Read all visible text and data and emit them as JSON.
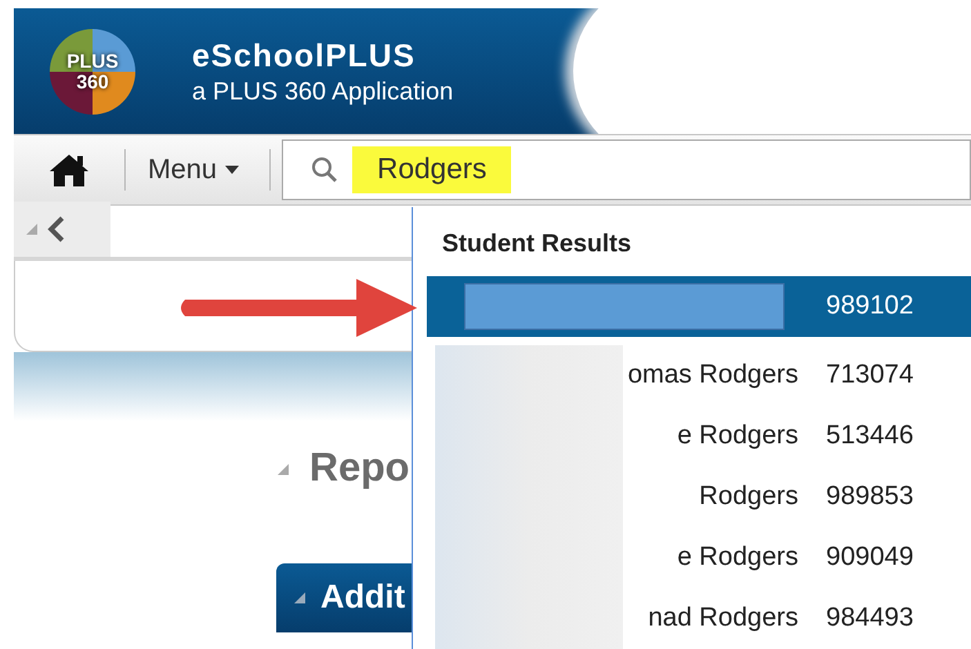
{
  "header": {
    "logo_text": [
      "PLUS",
      "360"
    ],
    "title": "eSchoolPLUS",
    "subtitle": "a PLUS 360 Application"
  },
  "toolbar": {
    "menu_label": "Menu",
    "search": {
      "value": "Rodgers",
      "highlighted": true
    }
  },
  "page": {
    "section_title": "Repo",
    "button_label": "Addit"
  },
  "results": {
    "title": "Student Results",
    "rows": [
      {
        "kind": "redacted",
        "id": "989102",
        "selected": true
      },
      {
        "kind": "blurred",
        "name": "omas Rodgers",
        "id": "713074",
        "selected": false
      },
      {
        "kind": "blurred",
        "name": "e Rodgers",
        "id": "513446",
        "selected": false
      },
      {
        "kind": "blurred",
        "name": "Rodgers",
        "id": "989853",
        "selected": false
      },
      {
        "kind": "blurred",
        "name": "e Rodgers",
        "id": "909049",
        "selected": false
      },
      {
        "kind": "blurred",
        "name": "nad Rodgers",
        "id": "984493",
        "selected": false
      }
    ]
  }
}
